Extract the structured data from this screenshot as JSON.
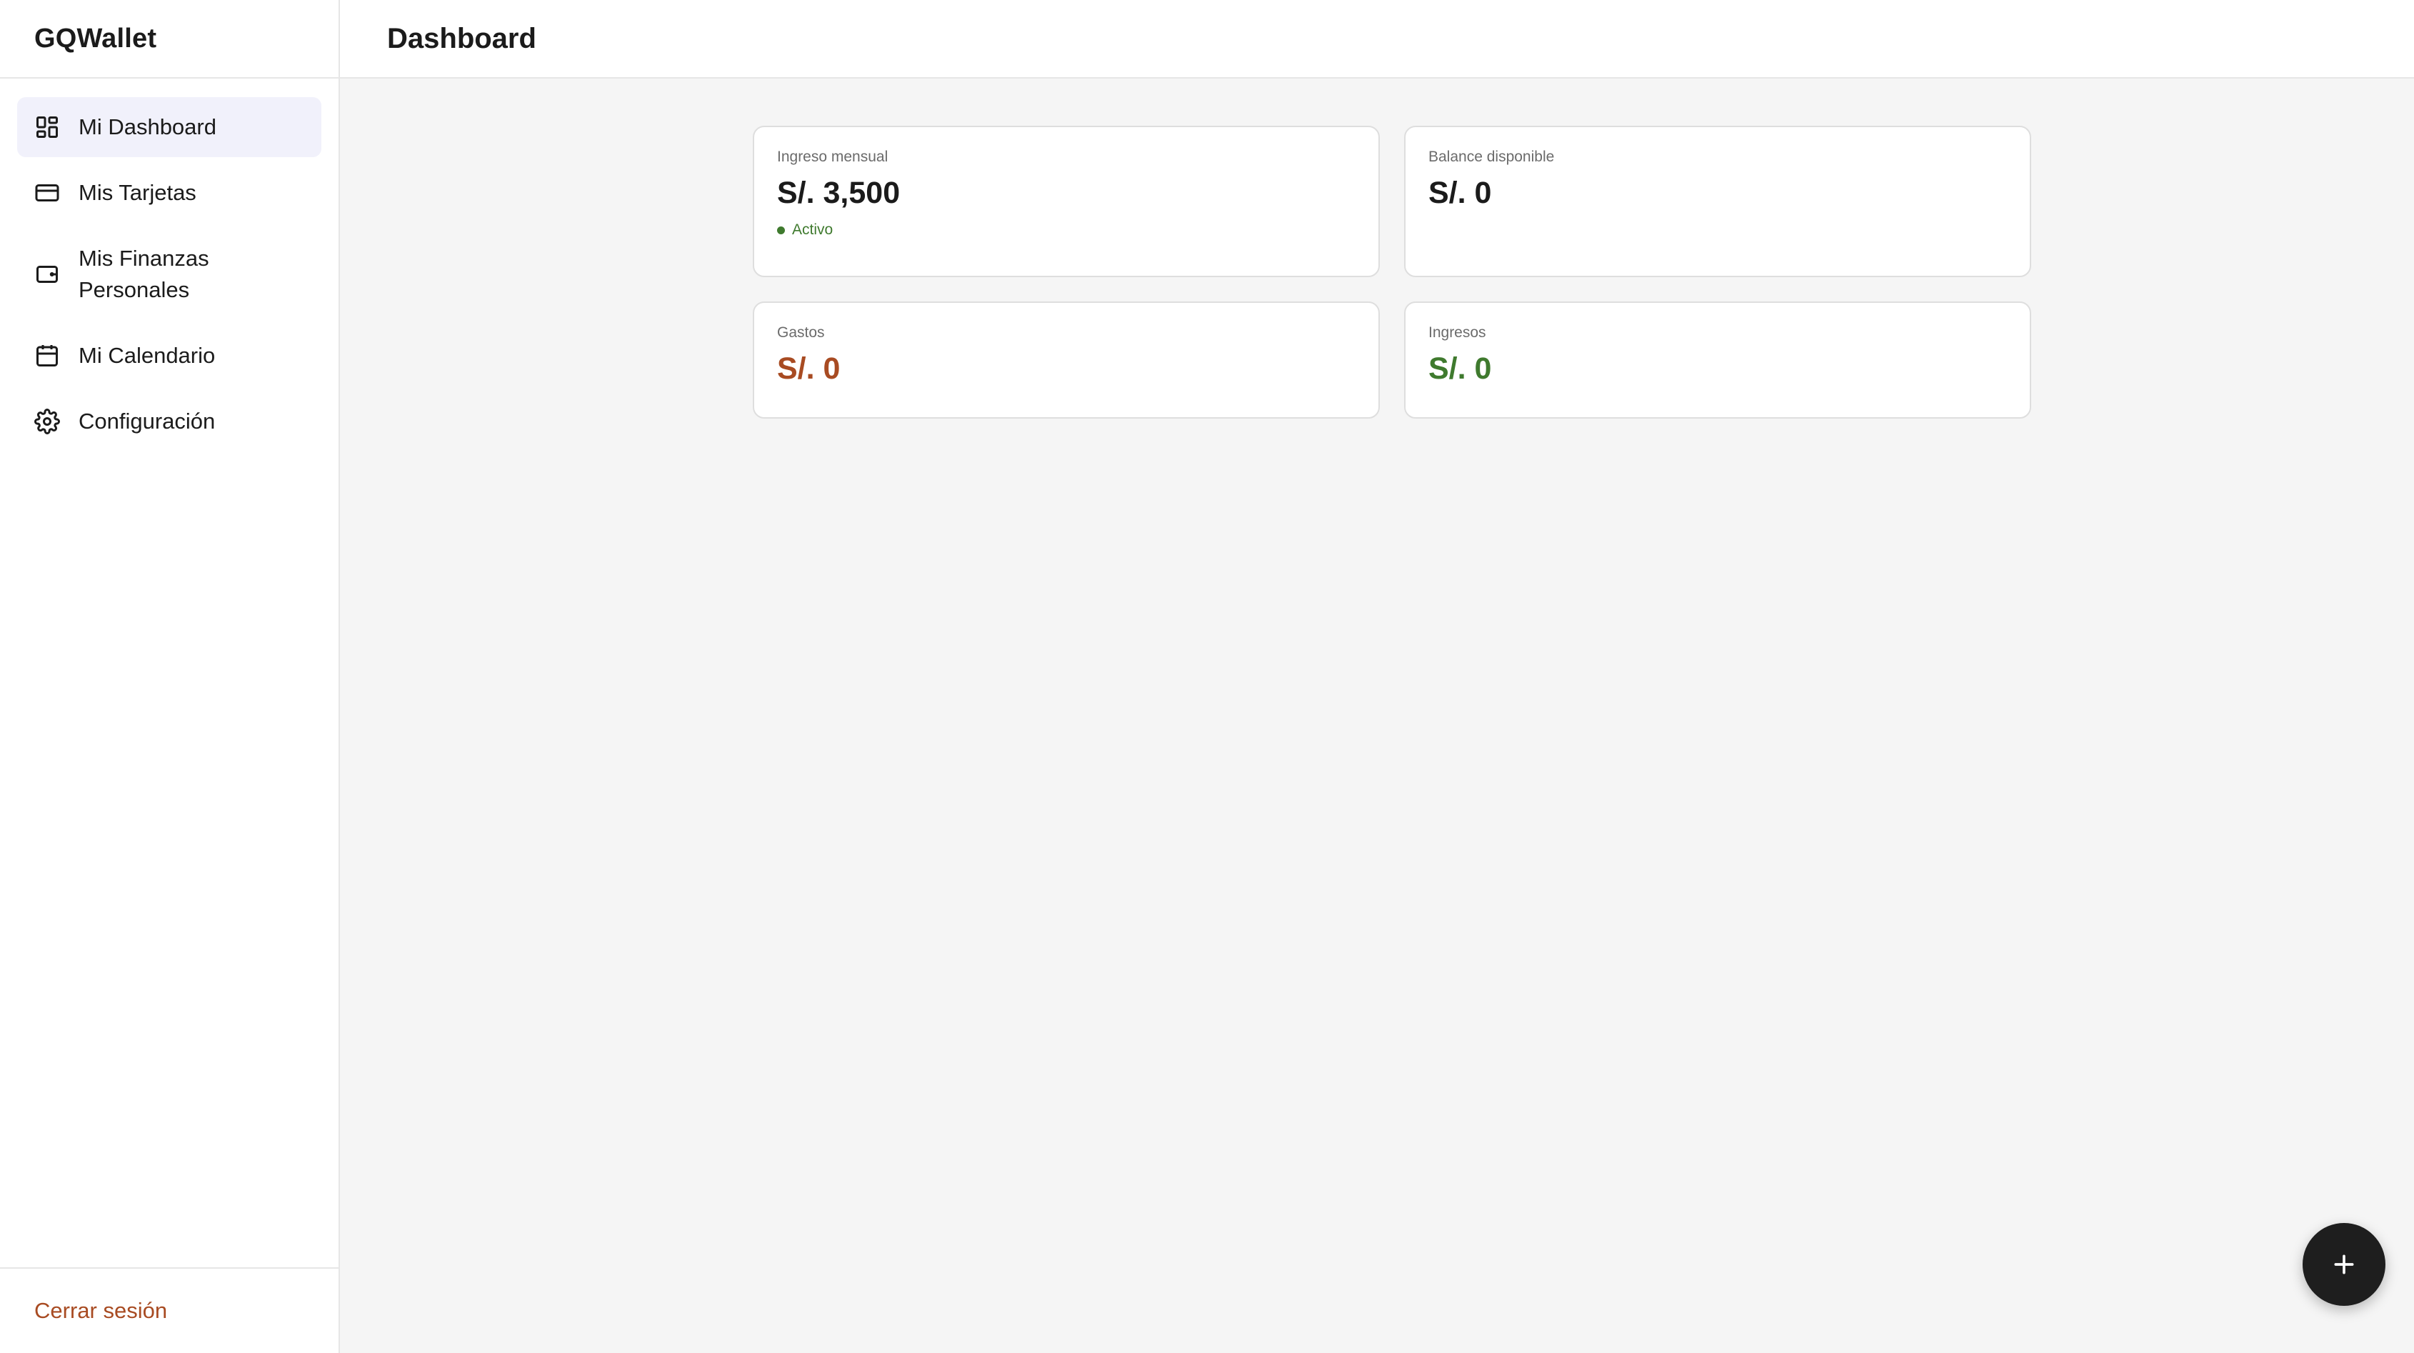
{
  "app": {
    "brand": "GQWallet"
  },
  "sidebar": {
    "items": [
      {
        "label": "Mi Dashboard",
        "icon": "dashboard-grid-icon",
        "active": true
      },
      {
        "label": "Mis Tarjetas",
        "icon": "credit-card-icon",
        "active": false
      },
      {
        "label": "Mis Finanzas Personales",
        "icon": "wallet-icon",
        "active": false
      },
      {
        "label": "Mi Calendario",
        "icon": "calendar-icon",
        "active": false
      },
      {
        "label": "Configuración",
        "icon": "gear-icon",
        "active": false
      }
    ],
    "logout_label": "Cerrar sesión"
  },
  "header": {
    "title": "Dashboard"
  },
  "cards": {
    "monthly_income": {
      "label": "Ingreso mensual",
      "value": "S/. 3,500",
      "status": "Activo"
    },
    "available_balance": {
      "label": "Balance disponible",
      "value": "S/. 0"
    },
    "expenses": {
      "label": "Gastos",
      "value": "S/. 0"
    },
    "income": {
      "label": "Ingresos",
      "value": "S/. 0"
    }
  },
  "fab": {
    "icon": "plus-icon"
  },
  "colors": {
    "accent_active_bg": "#f1f1fb",
    "expense": "#a84b22",
    "income": "#3f7a2e",
    "fab_bg": "#1e1e1e"
  }
}
